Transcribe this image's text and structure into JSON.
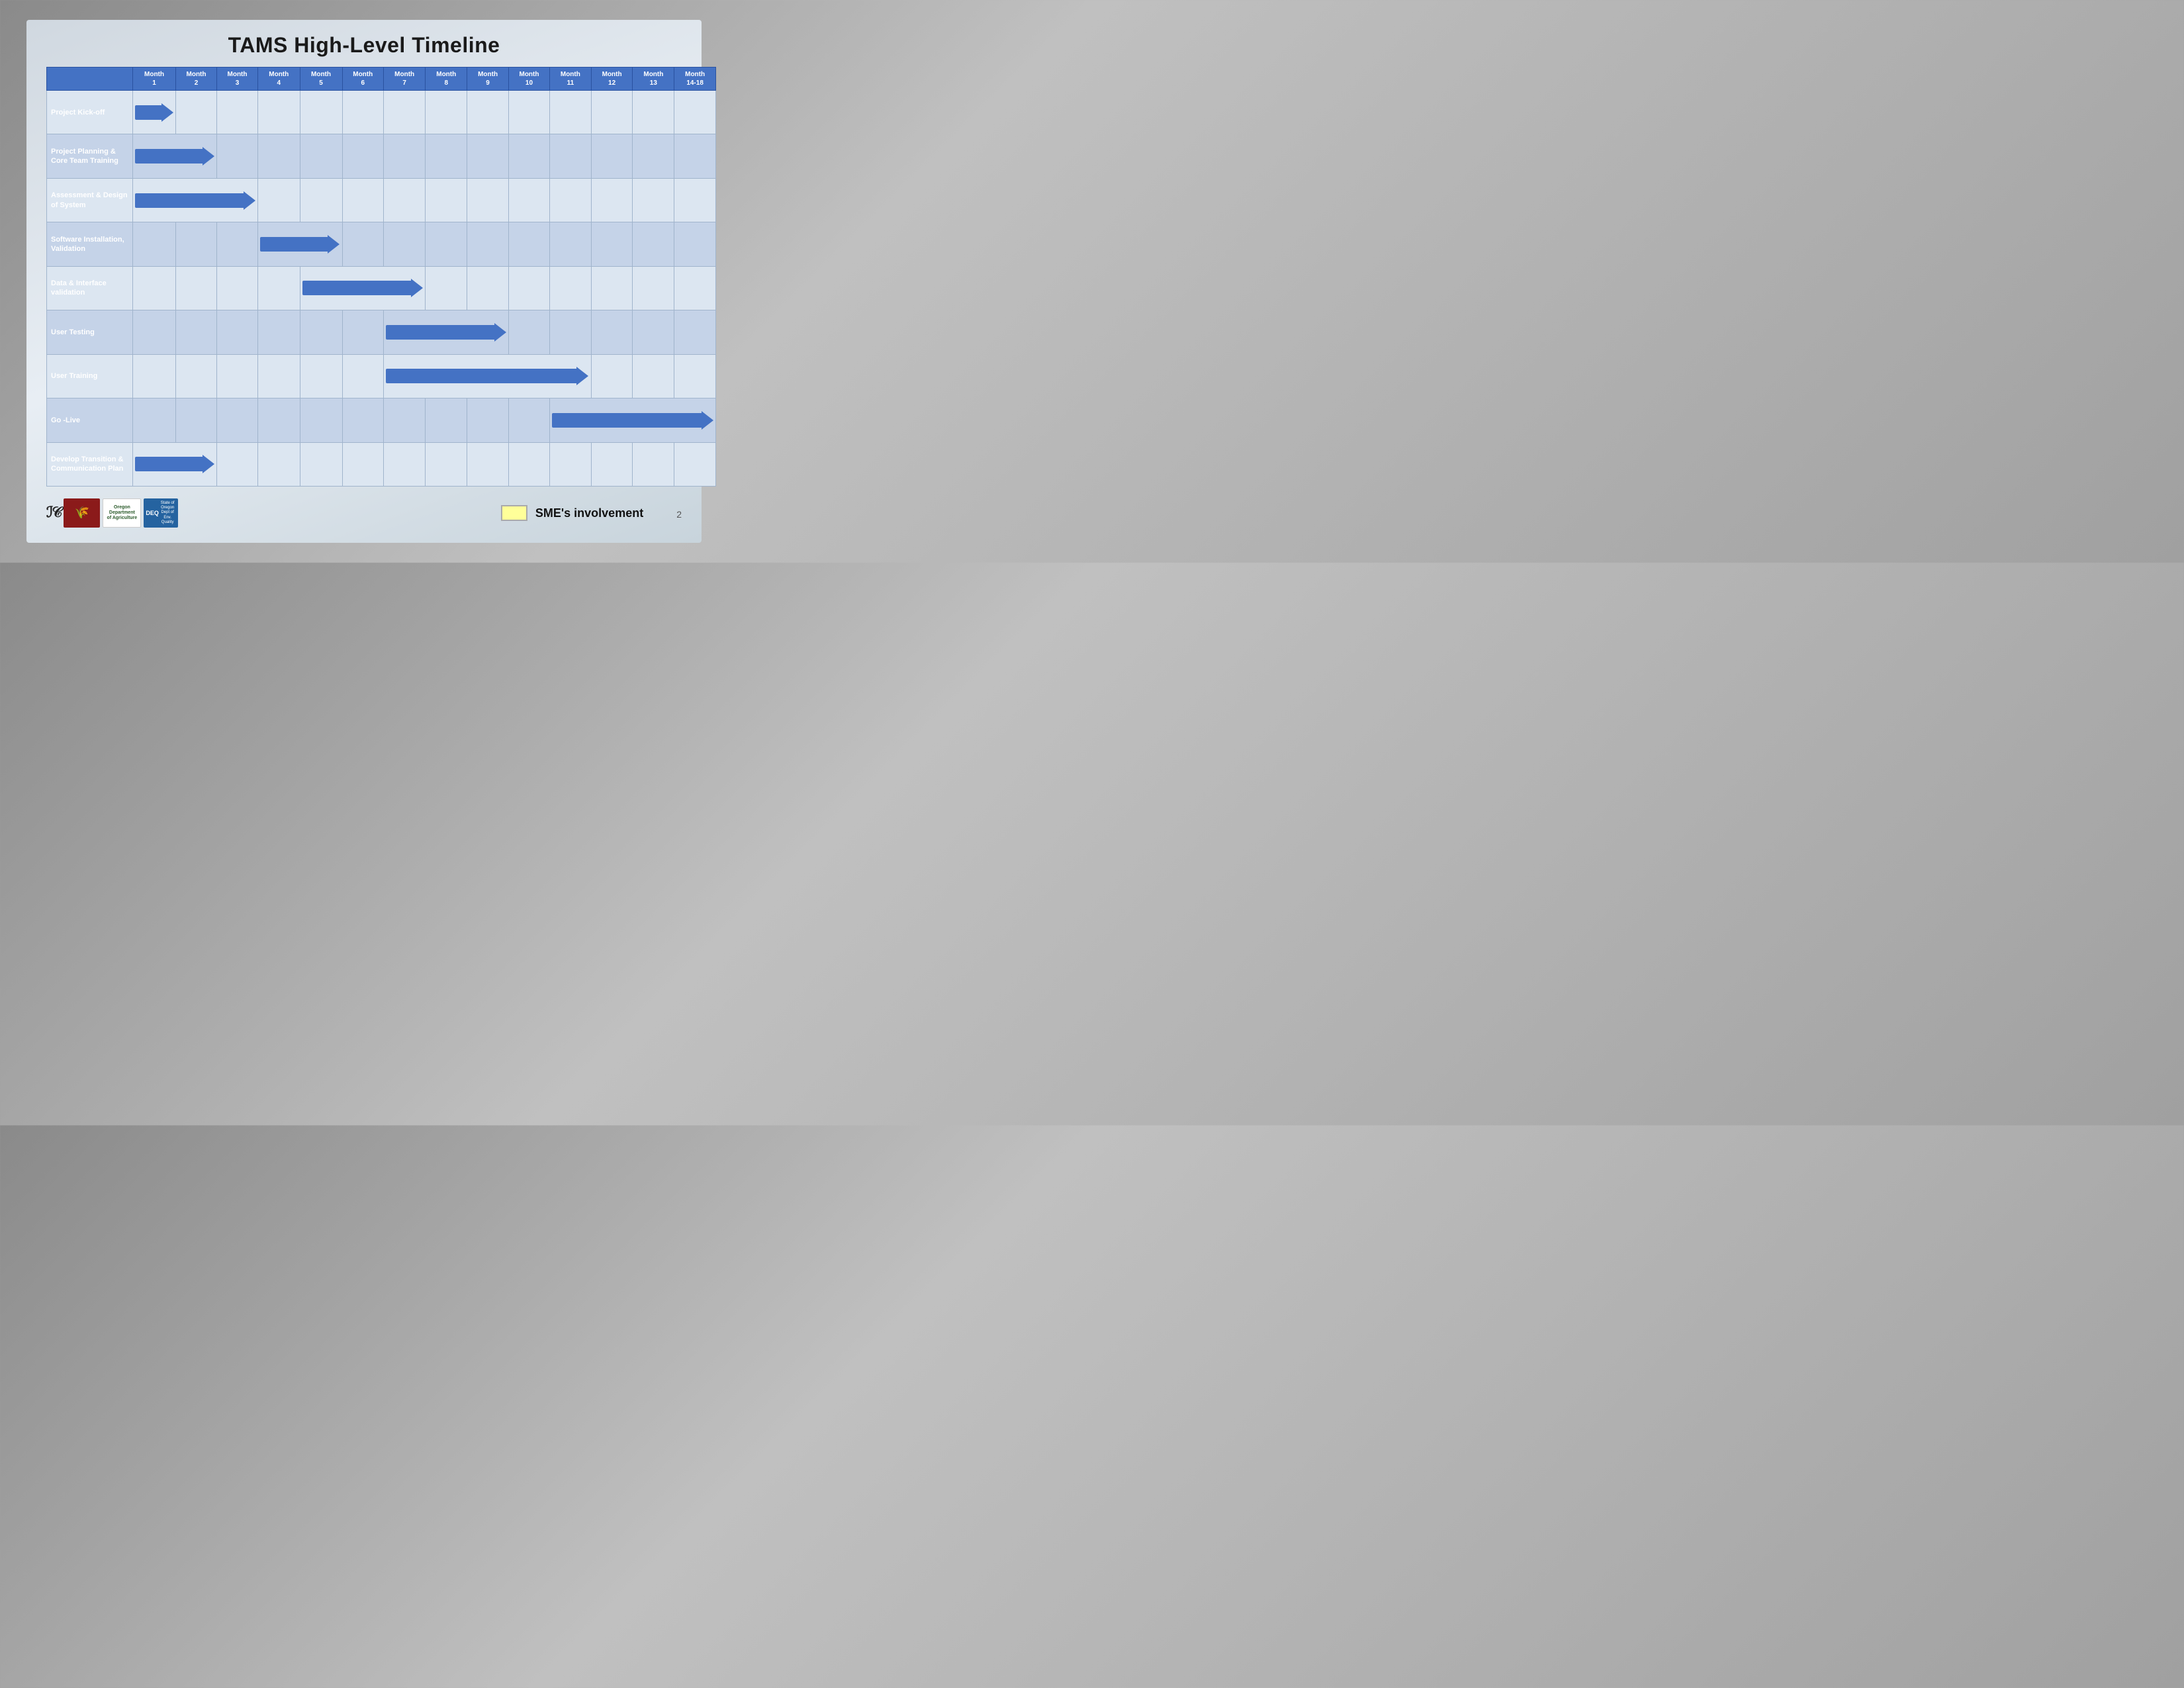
{
  "title": "TAMS High-Level Timeline",
  "months": [
    {
      "label": "Month",
      "sub": "1"
    },
    {
      "label": "Month",
      "sub": "2"
    },
    {
      "label": "Month",
      "sub": "3"
    },
    {
      "label": "Month",
      "sub": "4"
    },
    {
      "label": "Month",
      "sub": "5"
    },
    {
      "label": "Month",
      "sub": "6"
    },
    {
      "label": "Month",
      "sub": "7"
    },
    {
      "label": "Month",
      "sub": "8"
    },
    {
      "label": "Month",
      "sub": "9"
    },
    {
      "label": "Month",
      "sub": "10"
    },
    {
      "label": "Month",
      "sub": "11"
    },
    {
      "label": "Month",
      "sub": "12"
    },
    {
      "label": "Month",
      "sub": "13"
    },
    {
      "label": "Month",
      "sub": "14-18"
    }
  ],
  "rows": [
    {
      "label": "Project Kick-off",
      "arrow_start": 0,
      "arrow_cols": 1,
      "yellow": false
    },
    {
      "label": "Project Planning & Core Team Training",
      "arrow_start": 0,
      "arrow_cols": 2,
      "yellow": false,
      "tall": true
    },
    {
      "label": "Assessment & Design of System",
      "arrow_start": 0,
      "arrow_cols": 3,
      "yellow": true,
      "tall": true
    },
    {
      "label": "Software Installation, Validation",
      "arrow_start": 3,
      "arrow_cols": 2,
      "yellow": false,
      "tall": true
    },
    {
      "label": "Data & Interface validation",
      "arrow_start": 4,
      "arrow_cols": 3,
      "yellow": false,
      "tall": true
    },
    {
      "label": "User Testing",
      "arrow_start": 6,
      "arrow_cols": 3,
      "yellow": true
    },
    {
      "label": "User Training",
      "arrow_start": 6,
      "arrow_cols": 5,
      "yellow": true,
      "tall": true
    },
    {
      "label": "Go -Live",
      "arrow_start": 10,
      "arrow_cols": 4,
      "yellow": true
    },
    {
      "label": "Develop Transition & Communication Plan",
      "arrow_start": 0,
      "arrow_cols": 2,
      "yellow": false,
      "taller": true
    }
  ],
  "legend": {
    "text": "SME's involvement"
  },
  "footer": {
    "page_number": "2"
  }
}
